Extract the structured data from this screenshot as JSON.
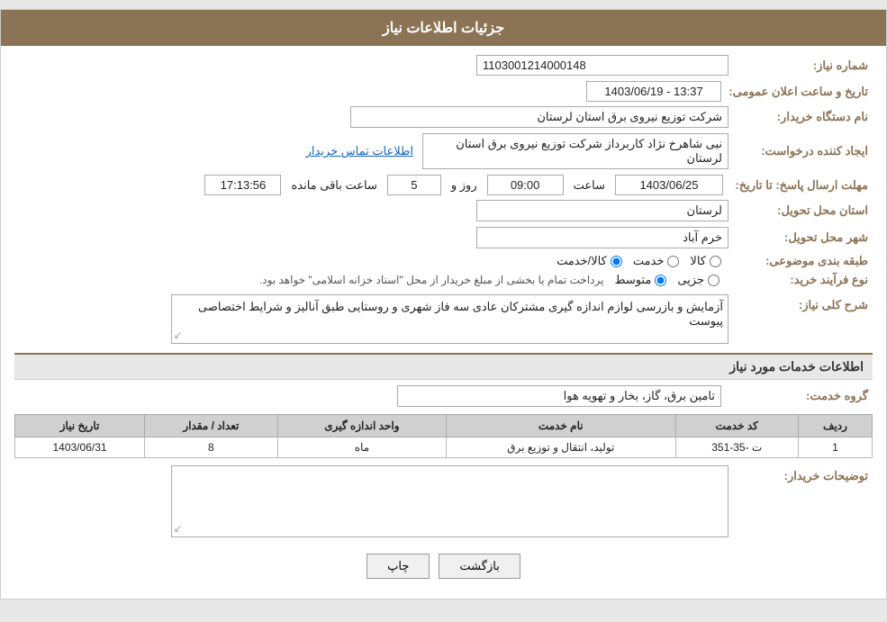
{
  "header": {
    "title": "جزئیات اطلاعات نیاز"
  },
  "fields": {
    "shomara_label": "شماره نیاز:",
    "shomara_value": "1103001214000148",
    "nam_dastgah_label": "نام دستگاه خریدار:",
    "nam_dastgah_value": "شرکت توزیع نیروی برق استان لرستان",
    "ijad_label": "ایجاد کننده درخواست:",
    "ijad_value": "نبی شاهرخ نژاد کاربرداز شرکت توزیع نیروی برق استان لرستان",
    "ejad_link": "اطلاعات تماس خریدار",
    "mohlat_label": "مهلت ارسال پاسخ: تا تاریخ:",
    "date_value": "1403/06/25",
    "saat_label": "ساعت",
    "saat_value": "09:00",
    "roz_label": "روز و",
    "roz_value": "5",
    "baqi_label": "ساعت باقی مانده",
    "time_remain": "17:13:56",
    "ostan_label": "استان محل تحویل:",
    "ostan_value": "لرستان",
    "shahr_label": "شهر محل تحویل:",
    "shahr_value": "خرم آباد",
    "tabaqe_label": "طبقه بندی موضوعی:",
    "tabaqe_options": [
      "کالا",
      "خدمت",
      "کالا/خدمت"
    ],
    "tabaqe_selected": "کالا",
    "nooa_label": "نوع فرآیند خرید:",
    "nooa_options": [
      "جزیی",
      "متوسط"
    ],
    "nooa_selected": "متوسط",
    "nooa_note": "پرداخت تمام یا بخشی از مبلغ خریدار از محل \"اسناد خزانه اسلامی\" خواهد بود.",
    "date_announce_label": "تاریخ و ساعت اعلان عمومی:",
    "date_announce_value": "1403/06/19 - 13:37",
    "sharh_label": "شرح کلی نیاز:",
    "sharh_value": "آزمایش و بازرسی لوازم اندازه گیری مشترکان عادی سه فاز شهری و روستایی طبق آنالیز  و شرایط اختصاصی پیوست",
    "service_section": "اطلاعات خدمات مورد نیاز",
    "grooh_label": "گروه خدمت:",
    "grooh_value": "تامین برق، گاز، بخار و تهویه هوا",
    "table": {
      "headers": [
        "ردیف",
        "کد خدمت",
        "نام خدمت",
        "واحد اندازه گیری",
        "تعداد / مقدار",
        "تاریخ نیاز"
      ],
      "rows": [
        {
          "radif": "1",
          "kod": "ت -35-351",
          "nam": "تولید، انتقال و توزیع برق",
          "vahed": "ماه",
          "tedad": "8",
          "tarikh": "1403/06/31"
        }
      ]
    },
    "tozihat_label": "توضیحات خریدار:",
    "tozihat_value": "",
    "btn_back": "بازگشت",
    "btn_print": "چاپ"
  }
}
